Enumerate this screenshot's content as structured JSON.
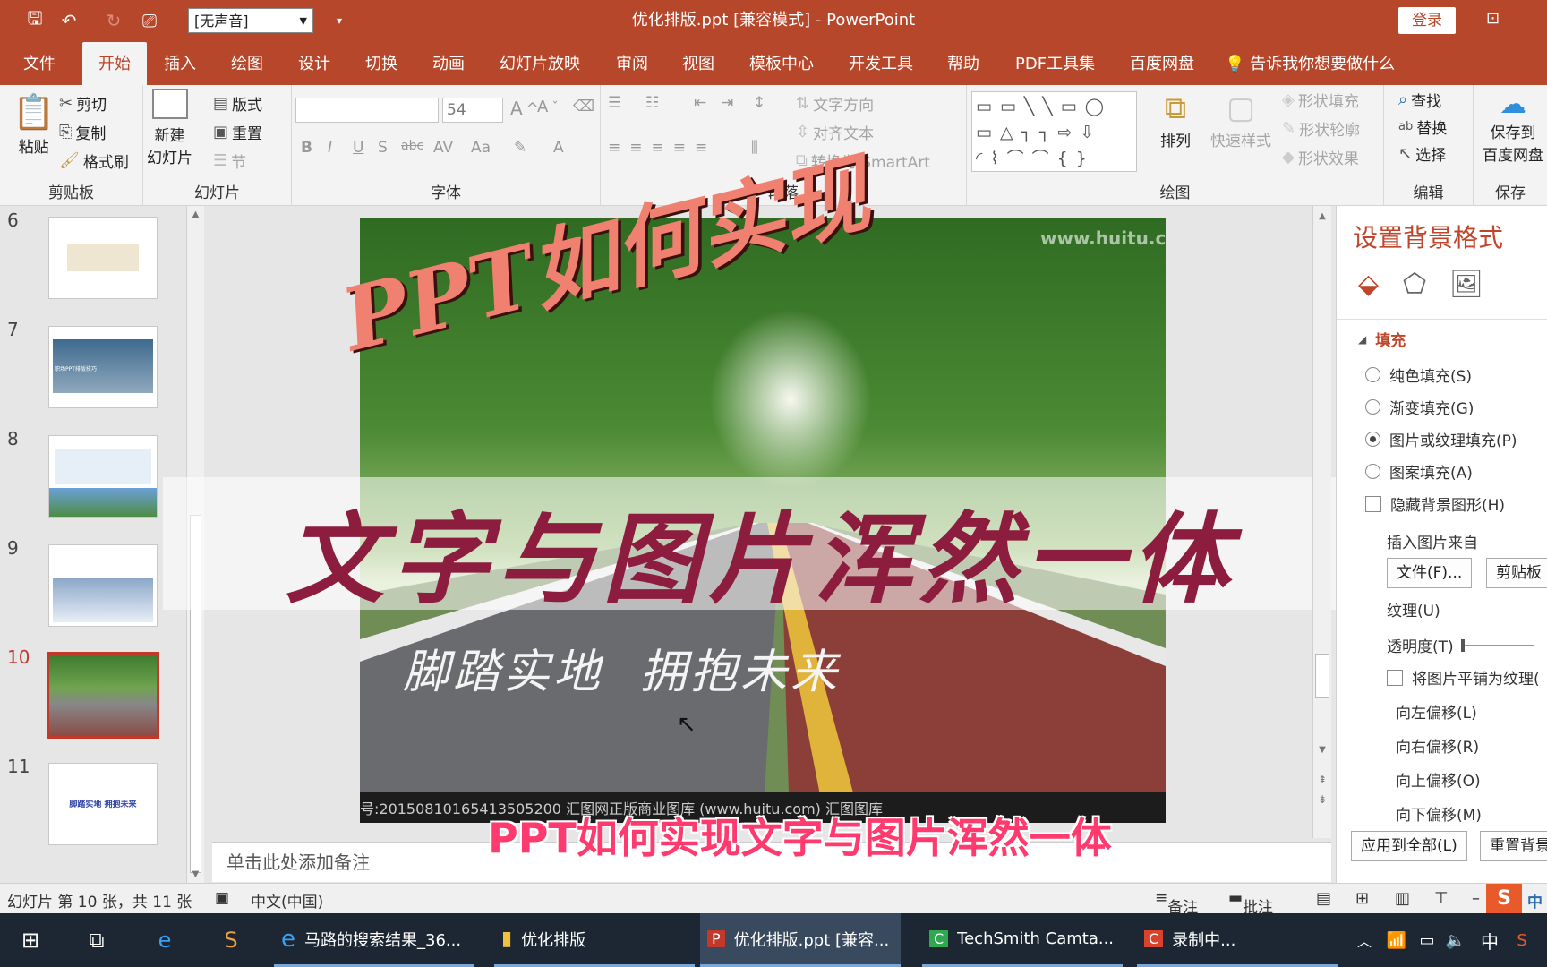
{
  "window": {
    "title": "优化排版.ppt [兼容模式]  -  PowerPoint",
    "sound_value": "[无声音]",
    "login_label": "登录"
  },
  "tabs": [
    "文件",
    "开始",
    "插入",
    "绘图",
    "设计",
    "切换",
    "动画",
    "幻灯片放映",
    "审阅",
    "视图",
    "模板中心",
    "开发工具",
    "帮助",
    "PDF工具集",
    "百度网盘",
    "告诉我你想要做什么"
  ],
  "ribbon": {
    "clipboard": {
      "paste": "粘贴",
      "cut": "剪切",
      "copy": "复制",
      "format_painter": "格式刷",
      "label": "剪贴板"
    },
    "slides": {
      "new_slide_line1": "新建",
      "new_slide_line2": "幻灯片",
      "layout": "版式",
      "reset": "重置",
      "section": "节",
      "label": "幻灯片"
    },
    "font": {
      "size": "54",
      "label": "字体"
    },
    "paragraph": {
      "text_direction": "文字方向",
      "align_text": "对齐文本",
      "smartart": "转换为 SmartArt",
      "label": "段落"
    },
    "drawing": {
      "arrange": "排列",
      "quick_styles": "快速样式",
      "shape_fill": "形状填充",
      "shape_outline": "形状轮廓",
      "shape_effects": "形状效果",
      "label": "绘图"
    },
    "editing": {
      "find": "查找",
      "replace": "替换",
      "select": "选择",
      "label": "编辑"
    },
    "save": {
      "line1": "保存到",
      "line2": "百度网盘",
      "label": "保存"
    }
  },
  "thumbnails": [
    {
      "num": "6"
    },
    {
      "num": "7"
    },
    {
      "num": "8"
    },
    {
      "num": "9"
    },
    {
      "num": "10"
    },
    {
      "num": "11"
    }
  ],
  "thumb_text": {
    "t7_title": "职场PPT排版技巧",
    "t11_text": "脚踏实地 拥抱未来"
  },
  "slide": {
    "headline": "PPT如何实现",
    "band_text": "文字与图片浑然一体",
    "subtitle": "脚踏实地  拥抱未来",
    "watermark_top": "www.huitu.co",
    "watermark_bottom": "号:20150810165413505200   汇图网正版商业图库 (www.huitu.com)  汇图图库"
  },
  "notes_placeholder": "单击此处添加备注",
  "caption": "PPT如何实现文字与图片浑然一体",
  "format_panel": {
    "title": "设置背景格式",
    "section": "填充",
    "fill_options": [
      "纯色填充(S)",
      "渐变填充(G)",
      "图片或纹理填充(P)",
      "图案填充(A)"
    ],
    "hide_bg": "隐藏背景图形(H)",
    "insert_from": "插入图片来自",
    "file_btn": "文件(F)...",
    "clipboard_btn": "剪贴板",
    "texture": "纹理(U)",
    "transparency": "透明度(T)",
    "tile": "将图片平铺为纹理(",
    "offsets": [
      "向左偏移(L)",
      "向右偏移(R)",
      "向上偏移(O)",
      "向下偏移(M)"
    ],
    "apply_all": "应用到全部(L)",
    "reset_bg": "重置背景"
  },
  "status": {
    "slide_info": "幻灯片 第 10 张，共 11 张",
    "language": "中文(中国)",
    "notes": "备注",
    "comments": "批注"
  },
  "taskbar": {
    "items": [
      "马路的搜索结果_36...",
      "优化排版",
      "优化排版.ppt [兼容...",
      "TechSmith Camta...",
      "录制中..."
    ],
    "ime": "中"
  }
}
